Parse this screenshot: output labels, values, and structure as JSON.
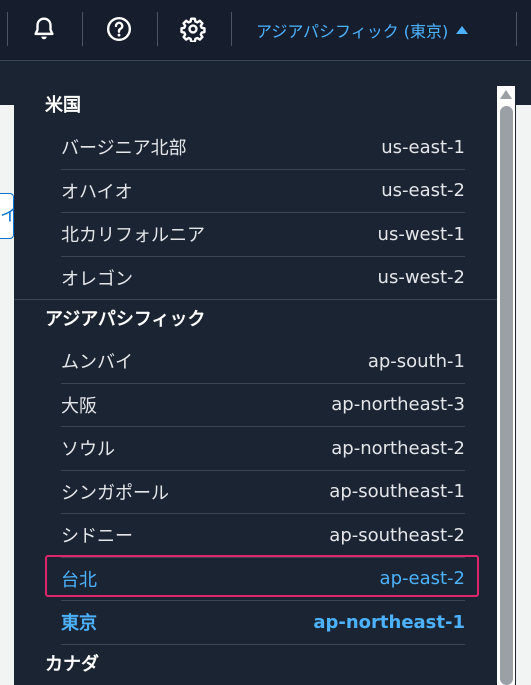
{
  "header": {
    "region_selector_label": "アジアパシフィック (東京)",
    "icons": [
      "bell-icon",
      "help-icon",
      "gear-icon"
    ]
  },
  "side_link_glyph": "イ",
  "region_menu": {
    "groups": [
      {
        "name": "米国",
        "regions": [
          {
            "name": "バージニア北部",
            "code": "us-east-1"
          },
          {
            "name": "オハイオ",
            "code": "us-east-2"
          },
          {
            "name": "北カリフォルニア",
            "code": "us-west-1"
          },
          {
            "name": "オレゴン",
            "code": "us-west-2"
          }
        ]
      },
      {
        "name": "アジアパシフィック",
        "regions": [
          {
            "name": "ムンバイ",
            "code": "ap-south-1"
          },
          {
            "name": "大阪",
            "code": "ap-northeast-3"
          },
          {
            "name": "ソウル",
            "code": "ap-northeast-2"
          },
          {
            "name": "シンガポール",
            "code": "ap-southeast-1"
          },
          {
            "name": "シドニー",
            "code": "ap-southeast-2"
          },
          {
            "name": "台北",
            "code": "ap-east-2",
            "state": "highlighted"
          },
          {
            "name": "東京",
            "code": "ap-northeast-1",
            "state": "selected"
          }
        ]
      },
      {
        "name": "カナダ",
        "regions": []
      }
    ]
  },
  "colors": {
    "accent": "#4cb2ff",
    "highlight_border": "#e0266b",
    "menu_background": "#1b2432"
  }
}
